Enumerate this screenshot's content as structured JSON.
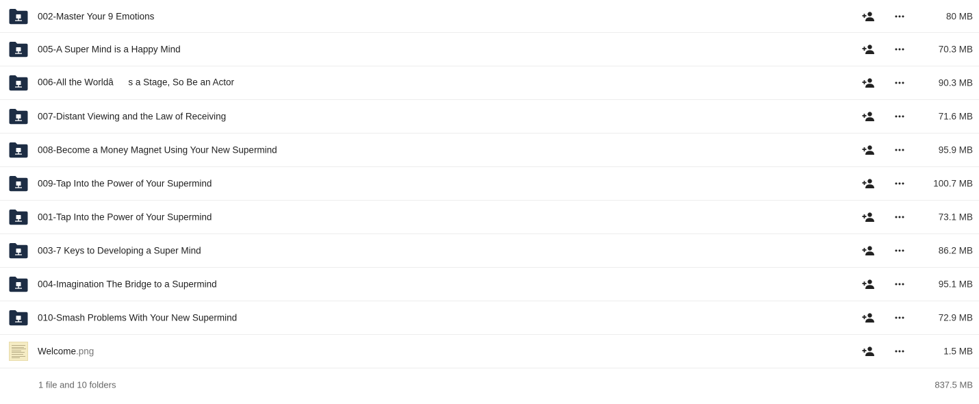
{
  "files": [
    {
      "type": "folder",
      "name": "002-Master Your 9 Emotions",
      "ext": "",
      "size": "80 MB"
    },
    {
      "type": "folder",
      "name": "005-A Super Mind is a Happy Mind",
      "ext": "",
      "size": "70.3 MB"
    },
    {
      "type": "folder",
      "name": "006-All the Worldâs a Stage, So Be an Actor",
      "ext": "",
      "size": "90.3 MB"
    },
    {
      "type": "folder",
      "name": "007-Distant Viewing and the Law of Receiving",
      "ext": "",
      "size": "71.6 MB"
    },
    {
      "type": "folder",
      "name": "008-Become a Money Magnet Using Your New Supermind",
      "ext": "",
      "size": "95.9 MB"
    },
    {
      "type": "folder",
      "name": "009-Tap Into the Power of Your Supermind",
      "ext": "",
      "size": "100.7 MB"
    },
    {
      "type": "folder",
      "name": "001-Tap Into the Power of Your Supermind",
      "ext": "",
      "size": "73.1 MB"
    },
    {
      "type": "folder",
      "name": "003-7 Keys to Developing a Super Mind",
      "ext": "",
      "size": "86.2 MB"
    },
    {
      "type": "folder",
      "name": "004-Imagination The Bridge to a Supermind",
      "ext": "",
      "size": "95.1 MB"
    },
    {
      "type": "folder",
      "name": "010-Smash Problems With Your New Supermind",
      "ext": "",
      "size": "72.9 MB"
    },
    {
      "type": "image",
      "name": "Welcome",
      "ext": ".png",
      "size": "1.5 MB"
    }
  ],
  "icons": {
    "folder": "shared-folder-icon",
    "share": "add-person-icon",
    "more": "more-options-icon"
  },
  "colors": {
    "folder": "#1d2d44",
    "action_icon": "#222222",
    "divider": "#ededed"
  },
  "footer": {
    "summary": "1 file and 10 folders",
    "total": "837.5 MB"
  }
}
